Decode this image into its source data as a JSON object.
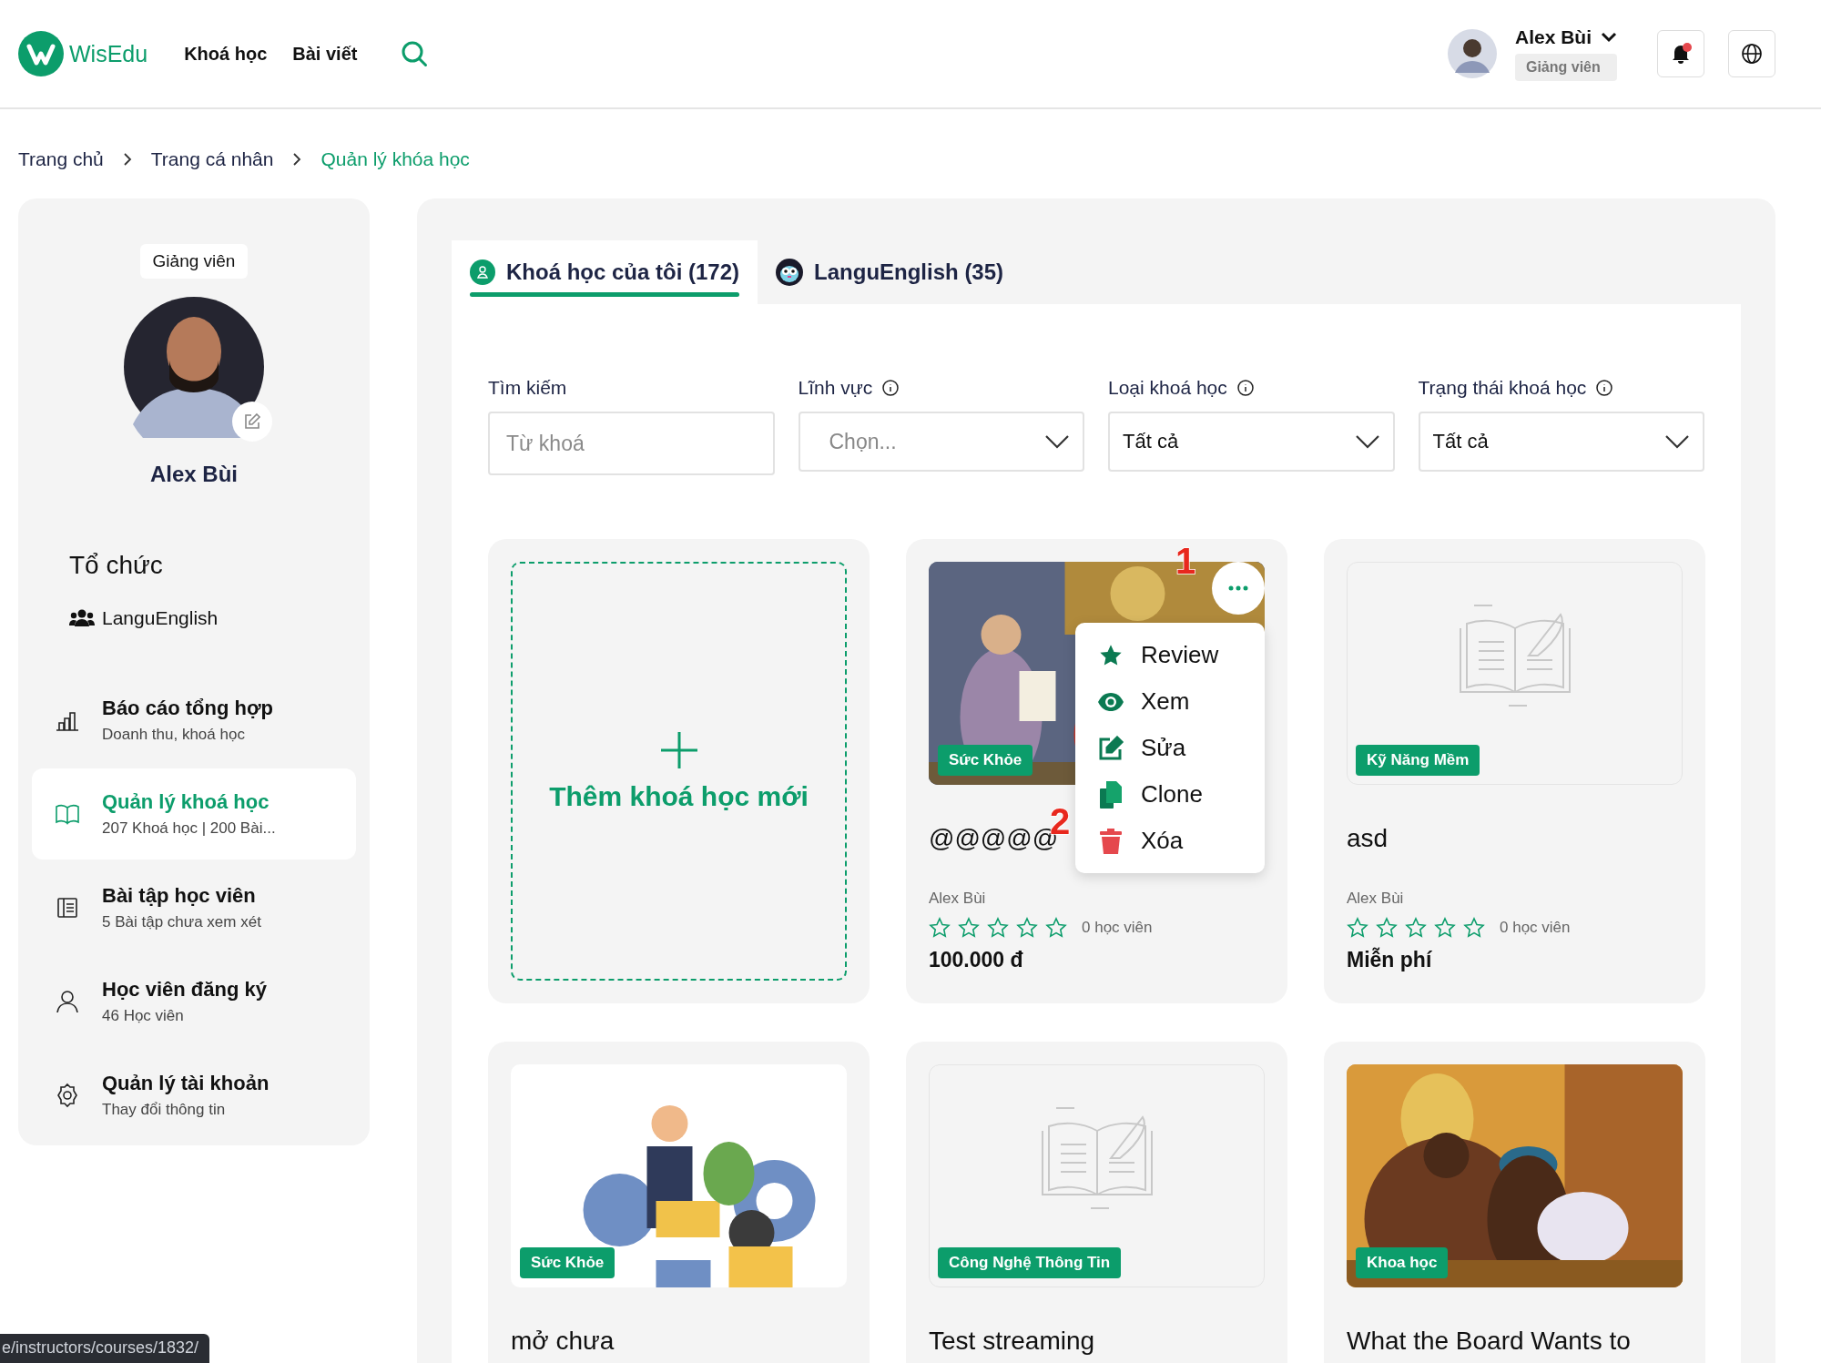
{
  "header": {
    "logo": "WisEdu",
    "nav": [
      {
        "label": "Khoá học"
      },
      {
        "label": "Bài viết"
      }
    ],
    "user": {
      "name": "Alex Bùi",
      "role": "Giảng viên"
    },
    "notifications": {
      "unread": true
    }
  },
  "breadcrumb": [
    {
      "label": "Trang chủ",
      "current": false
    },
    {
      "label": "Trang cá nhân",
      "current": false
    },
    {
      "label": "Quản lý khóa học",
      "current": true
    }
  ],
  "profile": {
    "role": "Giảng viên",
    "name": "Alex Bùi",
    "org_heading": "Tổ chức",
    "org": "LanguEnglish"
  },
  "menu": [
    {
      "kind": "report",
      "title": "Báo cáo tổng hợp",
      "subtitle": "Doanh thu, khoá học",
      "selected": false
    },
    {
      "kind": "courses",
      "title": "Quản lý khoá học",
      "subtitle": "207 Khoá học | 200 Bài...",
      "selected": true
    },
    {
      "kind": "assignments",
      "title": "Bài tập học viên",
      "subtitle": "5 Bài tập chưa xem xét",
      "selected": false
    },
    {
      "kind": "students",
      "title": "Học viên đăng ký",
      "subtitle": "46 Học viên",
      "selected": false
    },
    {
      "kind": "account",
      "title": "Quản lý tài khoản",
      "subtitle": "Thay đổi thông tin",
      "selected": false
    }
  ],
  "tabs": [
    {
      "kind": "user",
      "label": "Khoá học của tôi (172)",
      "selected": true
    },
    {
      "kind": "org",
      "label": "LanguEnglish (35)",
      "selected": false
    }
  ],
  "filters": [
    {
      "kind": "text",
      "label": "Tìm kiếm",
      "info": false,
      "placeholder": "Từ khoá"
    },
    {
      "kind": "select",
      "label": "Lĩnh vực",
      "info": true,
      "placeholder": "Chọn..."
    },
    {
      "kind": "select",
      "label": "Loại khoá học",
      "info": true,
      "value": "Tất cả"
    },
    {
      "kind": "select",
      "label": "Trạng thái khoá học",
      "info": true,
      "value": "Tất cả"
    }
  ],
  "add_card": {
    "label": "Thêm khoá học mới"
  },
  "courses": [
    {
      "kind": "picture",
      "tag": "Sức Khỏe",
      "title": "@@@@@",
      "author": "Alex Bùi",
      "stars": 0,
      "students": "0 học viên",
      "price": "100.000 đ",
      "menu_open": true
    },
    {
      "kind": "placeholder",
      "tag": "Kỹ Năng Mềm",
      "title": "asd",
      "author": "Alex Bùi",
      "stars": 0,
      "students": "0 học viên",
      "price": "Miễn phí",
      "menu_open": false
    },
    {
      "kind": "picture",
      "tag": "Sức Khỏe",
      "title": "mở chưa",
      "menu_open": false
    },
    {
      "kind": "placeholder",
      "tag": "Công Nghệ Thông Tin",
      "title": "Test streaming",
      "menu_open": false
    },
    {
      "kind": "picture",
      "tag": "Khoa học",
      "title": "What the Board Wants to",
      "menu_open": false
    }
  ],
  "context_menu": [
    {
      "kind": "review",
      "label": "Review"
    },
    {
      "kind": "view",
      "label": "Xem"
    },
    {
      "kind": "edit",
      "label": "Sửa"
    },
    {
      "kind": "clone",
      "label": "Clone"
    },
    {
      "kind": "delete",
      "label": "Xóa"
    }
  ],
  "annotations": [
    "1",
    "2"
  ],
  "status_url": "e/instructors/courses/1832/"
}
